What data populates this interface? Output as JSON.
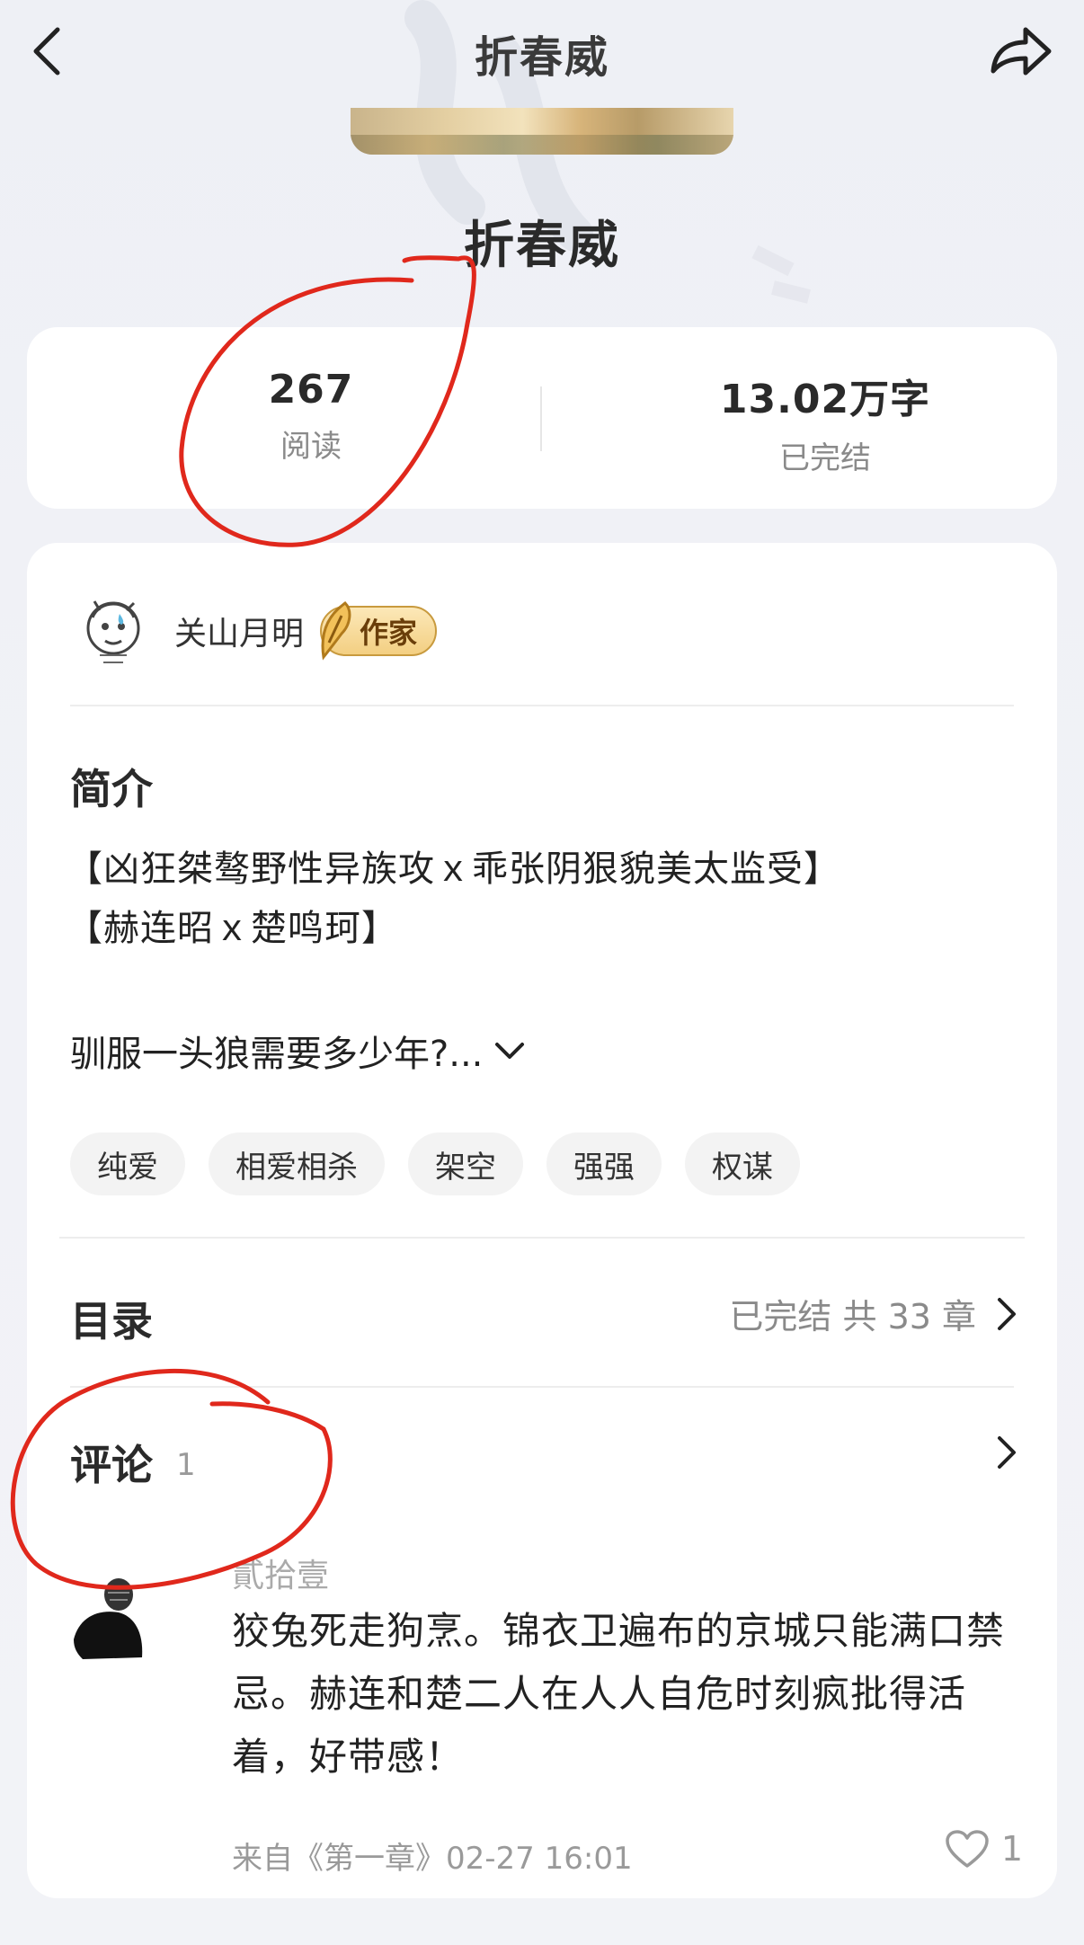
{
  "header": {
    "title": "折春威",
    "back_icon": "chevron-left-icon",
    "share_icon": "share-icon"
  },
  "book": {
    "title": "折春威"
  },
  "stats": {
    "reads_value": "267",
    "reads_label": "阅读",
    "words_value": "13.02万字",
    "status_label": "已完结"
  },
  "author": {
    "name": "关山月明",
    "badge": "作家"
  },
  "intro": {
    "heading": "简介",
    "line1": "【凶狂桀骜野性异族攻ｘ乖张阴狠貌美太监受】",
    "line2": "【赫连昭ｘ楚鸣珂】",
    "line3": "驯服一头狼需要多少年?..."
  },
  "tags": [
    "纯爱",
    "相爱相杀",
    "架空",
    "强强",
    "权谋"
  ],
  "toc": {
    "heading": "目录",
    "summary": "已完结 共 33 章"
  },
  "comments": {
    "heading": "评论",
    "count": "1",
    "items": [
      {
        "user": "貳拾壹",
        "text": "狡兔死走狗烹。锦衣卫遍布的京城只能满口禁忌。赫连和楚二人在人人自危时刻疯批得活着，好带感！",
        "meta": "来自《第一章》02-27 16:01",
        "likes": "1"
      }
    ]
  },
  "colors": {
    "background": "#f1f2f7",
    "card": "#ffffff",
    "annotation": "#e0281c",
    "badge_gold": "#f3cf82"
  }
}
